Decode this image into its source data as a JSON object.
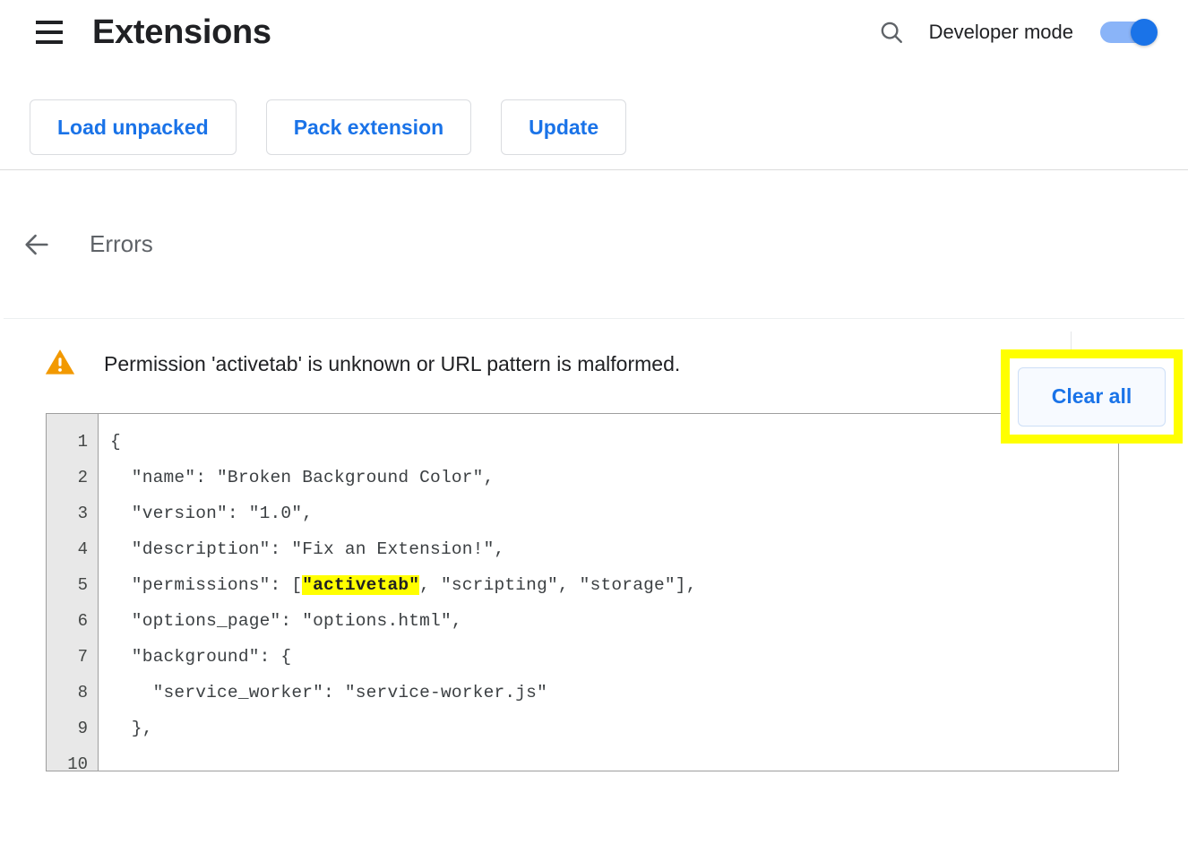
{
  "header": {
    "menu_icon": "hamburger-menu-icon",
    "title": "Extensions",
    "search_icon": "search-icon",
    "developer_mode_label": "Developer mode",
    "developer_mode_enabled": true,
    "toggle_on_color": "#1a73e8",
    "toggle_track_color": "#8ab4f8"
  },
  "toolbar": {
    "load_unpacked_label": "Load unpacked",
    "pack_extension_label": "Pack extension",
    "update_label": "Update",
    "link_color": "#1a73e8"
  },
  "errors_header": {
    "back_icon": "back-arrow-icon",
    "title": "Errors",
    "clear_all_label": "Clear all",
    "highlight_color": "#ffff00"
  },
  "error_entry": {
    "severity_icon": "warning-triangle-icon",
    "severity_color": "#f29900",
    "message": "Permission 'activetab' is unknown or URL pattern is malformed.",
    "collapse_icon": "chevron-up-icon",
    "delete_icon": "trash-icon"
  },
  "code_viewer": {
    "line_numbers": [
      "1",
      "2",
      "3",
      "4",
      "5",
      "6",
      "7",
      "8",
      "9",
      "10"
    ],
    "lines": [
      {
        "pre": "{",
        "hl": "",
        "post": ""
      },
      {
        "pre": "  \"name\": \"Broken Background Color\",",
        "hl": "",
        "post": ""
      },
      {
        "pre": "  \"version\": \"1.0\",",
        "hl": "",
        "post": ""
      },
      {
        "pre": "  \"description\": \"Fix an Extension!\",",
        "hl": "",
        "post": ""
      },
      {
        "pre": "  \"permissions\": [",
        "hl": "\"activetab\"",
        "post": ", \"scripting\", \"storage\"],"
      },
      {
        "pre": "  \"options_page\": \"options.html\",",
        "hl": "",
        "post": ""
      },
      {
        "pre": "  \"background\": {",
        "hl": "",
        "post": ""
      },
      {
        "pre": "    \"service_worker\": \"service-worker.js\"",
        "hl": "",
        "post": ""
      },
      {
        "pre": "  },",
        "hl": "",
        "post": ""
      },
      {
        "pre": "",
        "hl": "",
        "post": ""
      }
    ],
    "highlight_color": "#ffff00"
  }
}
